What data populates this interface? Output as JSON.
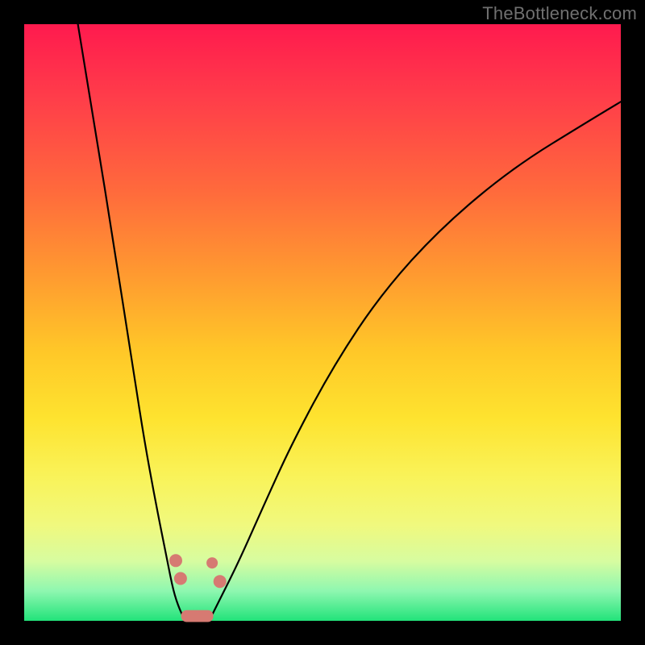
{
  "watermark": "TheBottleneck.com",
  "colors": {
    "gradient_top": "#ff1a4e",
    "gradient_mid_upper": "#ff9a30",
    "gradient_mid": "#fee32f",
    "gradient_lower": "#d7fca0",
    "gradient_bottom": "#22e37a",
    "curve": "#000000",
    "marker": "#d67a72",
    "frame": "#000000"
  },
  "chart_data": {
    "type": "line",
    "title": "",
    "xlabel": "",
    "ylabel": "",
    "xlim": [
      0,
      100
    ],
    "ylim": [
      0,
      100
    ],
    "series": [
      {
        "name": "left-curve",
        "x": [
          9,
          12,
          15,
          18,
          20,
          22,
          24,
          25,
          26,
          27
        ],
        "values": [
          100,
          82,
          63,
          44,
          31,
          20,
          10,
          5,
          2,
          0
        ]
      },
      {
        "name": "right-curve",
        "x": [
          31,
          33,
          36,
          40,
          45,
          52,
          60,
          70,
          82,
          95,
          100
        ],
        "values": [
          0,
          4,
          10,
          19,
          30,
          43,
          55,
          66,
          76,
          84,
          87
        ]
      }
    ],
    "markers": [
      {
        "shape": "circle",
        "x": 25.4,
        "y": 10.1
      },
      {
        "shape": "circle",
        "x": 26.2,
        "y": 7.1
      },
      {
        "shape": "circle",
        "x": 31.5,
        "y": 9.7
      },
      {
        "shape": "circle",
        "x": 32.8,
        "y": 6.6
      },
      {
        "shape": "pill",
        "x": 29.0,
        "y": 0.8,
        "w": 5.4,
        "h": 2.0
      }
    ]
  }
}
